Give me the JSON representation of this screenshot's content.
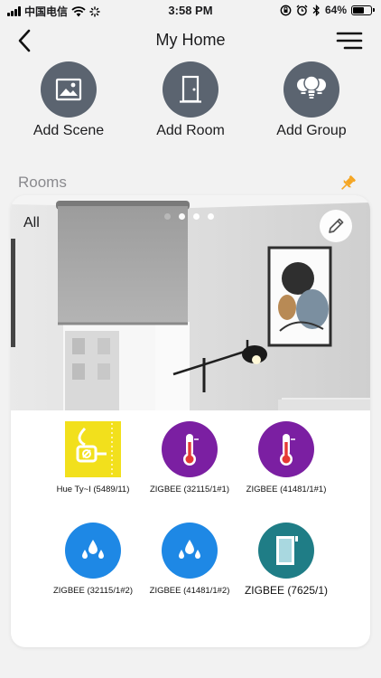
{
  "status_bar": {
    "carrier": "中国电信",
    "time": "3:58 PM",
    "battery": "64%",
    "battery_level": 0.64
  },
  "header": {
    "title": "My Home",
    "back_icon": "back-arrow-icon",
    "menu_icon": "menu-icon"
  },
  "actions": [
    {
      "label": "Add Scene",
      "icon": "picture-icon"
    },
    {
      "label": "Add Room",
      "icon": "door-icon"
    },
    {
      "label": "Add Group",
      "icon": "bulbs-icon"
    }
  ],
  "rooms": {
    "heading": "Rooms",
    "pin_icon": "pin-icon",
    "card": {
      "name": "All",
      "page_count": 4,
      "active_page": 0
    }
  },
  "devices": [
    {
      "label": "Hue Ty~I (5489/11)",
      "icon": "plug-icon",
      "color": "#f2e01c"
    },
    {
      "label": "ZIGBEE (32115/1#1)",
      "icon": "thermometer-icon",
      "color": "#7b1fa2"
    },
    {
      "label": "ZIGBEE (41481/1#1)",
      "icon": "thermometer-icon",
      "color": "#7b1fa2"
    },
    {
      "label": "ZIGBEE (32115/1#2)",
      "icon": "humidity-icon",
      "color": "#1e88e5"
    },
    {
      "label": "ZIGBEE (41481/1#2)",
      "icon": "humidity-icon",
      "color": "#1e88e5"
    },
    {
      "label": "ZIGBEE (7625/1)",
      "icon": "window-sensor-icon",
      "color": "#1f7d86"
    }
  ],
  "colors": {
    "action_circle": "#5b6470",
    "pin": "#f5a623",
    "background": "#f2f2f2"
  }
}
